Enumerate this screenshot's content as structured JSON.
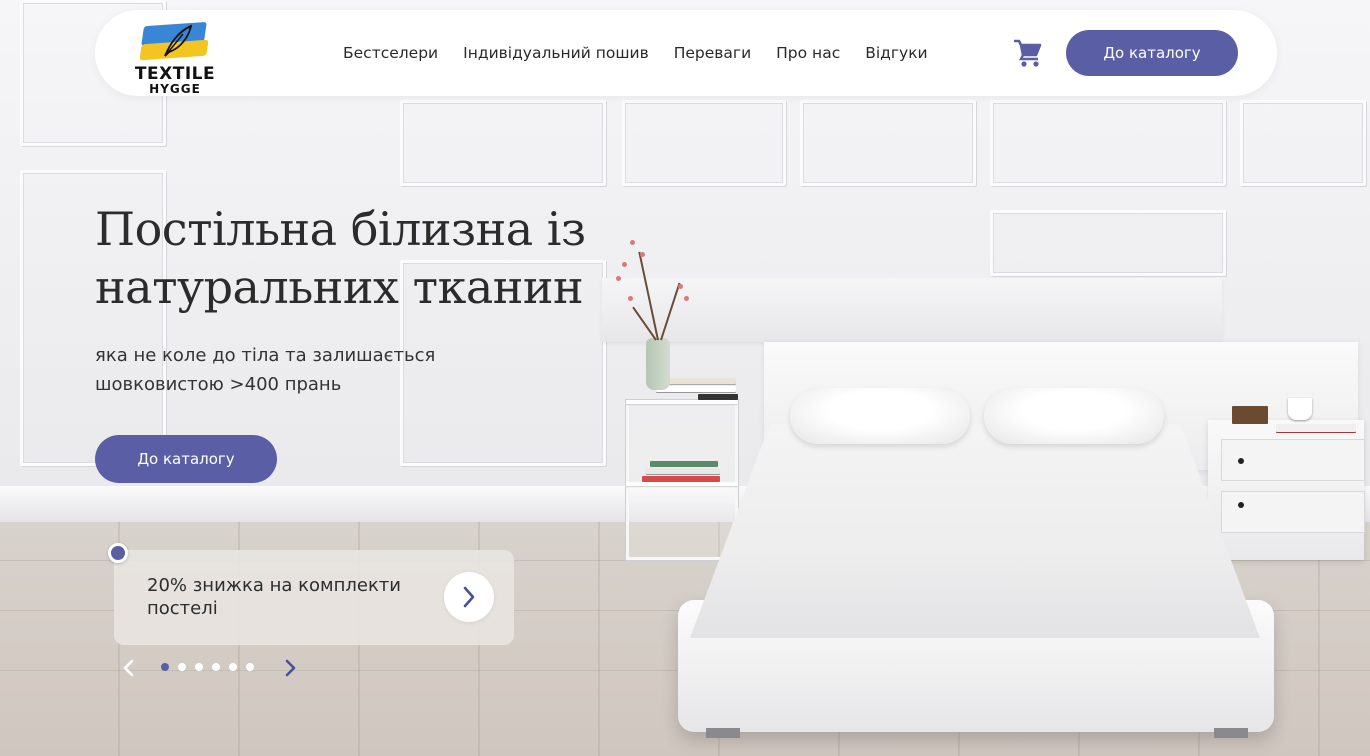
{
  "brand": {
    "logo_line1": "TEXTILE",
    "logo_line2": "HYGGE",
    "flag_blue": "#3a86d6",
    "flag_yellow": "#f3c521"
  },
  "nav": {
    "items": [
      {
        "label": "Бестселери"
      },
      {
        "label": "Індивідуальний пошив"
      },
      {
        "label": "Переваги"
      },
      {
        "label": "Про нас"
      },
      {
        "label": "Відгуки"
      }
    ],
    "cart_icon": "shopping-cart-icon",
    "cta_label": "До каталогу"
  },
  "hero": {
    "title_line1": "Постільна білизна із",
    "title_line2": "натуральних тканин",
    "subtitle_line1": "яка не коле до тіла та залишається",
    "subtitle_line2": "шовковистою >400 прань",
    "cta_label": "До каталогу"
  },
  "promo": {
    "text_line1": "20% знижка на комплекти",
    "text_line2": "постелі",
    "arrow_icon": "chevron-right-icon"
  },
  "slider": {
    "prev_icon": "chevron-left-icon",
    "next_icon": "chevron-right-icon",
    "total_slides": 6,
    "active_index": 0
  },
  "colors": {
    "accent": "#5a5fa5",
    "header_bg": "#ffffff",
    "text": "#2b2b2b"
  }
}
